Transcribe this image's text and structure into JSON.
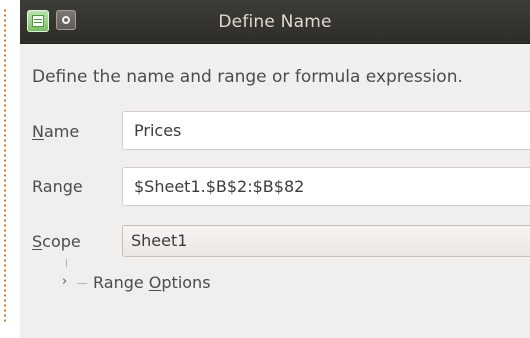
{
  "dialog": {
    "title": "Define Name",
    "description": "Define the name and range or formula expression."
  },
  "fields": {
    "name": {
      "label_accel": "N",
      "label_rest": "ame",
      "value": "Prices"
    },
    "range": {
      "label": "Range",
      "value": "$Sheet1.$B$2:$B$82"
    },
    "scope": {
      "label_accel": "S",
      "label_rest": "cope",
      "value": "Sheet1"
    }
  },
  "range_options": {
    "label_prefix": "Range ",
    "label_accel": "O",
    "label_rest": "ptions"
  },
  "icons": {
    "app": "spreadsheet-app-icon",
    "window": "window-menu-icon",
    "expander": "expand-right-icon"
  },
  "colors": {
    "titlebar": "#36342f",
    "dialog_background": "#f1efed",
    "field_text": "#3c3c3c",
    "label_text": "#4c4c4c",
    "dotted_border": "#c8752a",
    "app_icon_green": "#78bc61"
  }
}
